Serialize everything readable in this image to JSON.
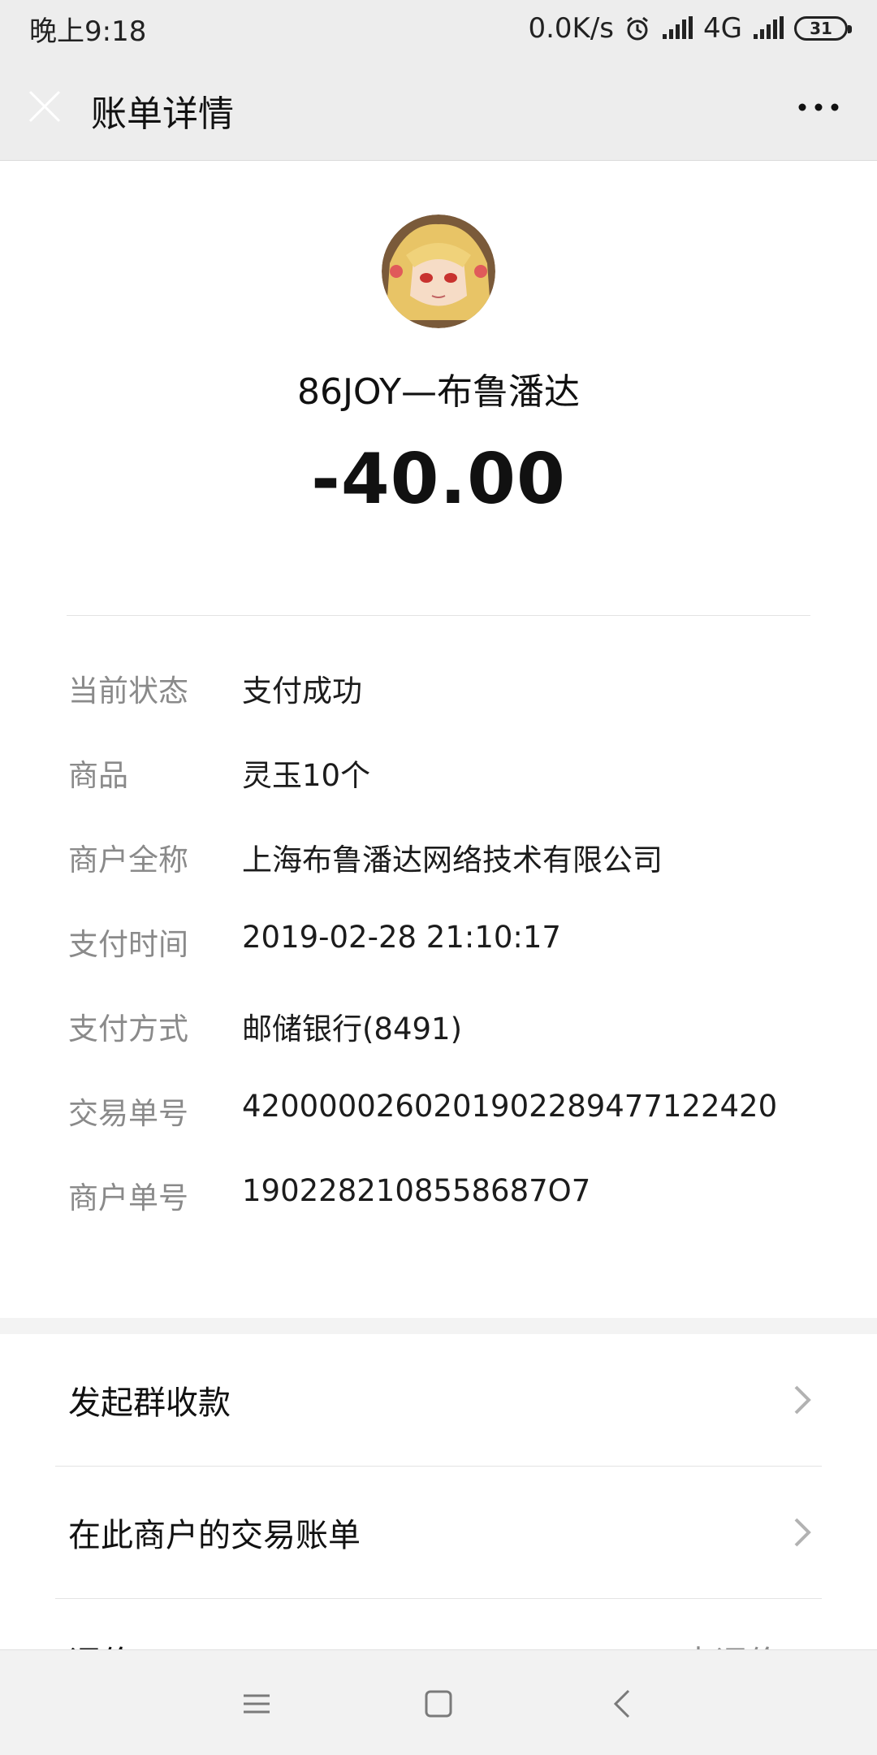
{
  "status_bar": {
    "time": "晚上9:18",
    "net_speed": "0.0K/s",
    "network": "4G",
    "battery": "31"
  },
  "header": {
    "title": "账单详情",
    "close_icon": "close-icon",
    "more_icon": "more-dots-icon"
  },
  "merchant": {
    "name": "86JOY—布鲁潘达",
    "amount": "-40.00"
  },
  "details": [
    {
      "label": "当前状态",
      "value": "支付成功"
    },
    {
      "label": "商品",
      "value": "灵玉10个"
    },
    {
      "label": "商户全称",
      "value": "上海布鲁潘达网络技术有限公司"
    },
    {
      "label": "支付时间",
      "value": "2019-02-28 21:10:17"
    },
    {
      "label": "支付方式",
      "value": "邮储银行(8491)"
    },
    {
      "label": "交易单号",
      "value": "4200000260201902289477122420"
    },
    {
      "label": "商户单号",
      "value": "1902282108558687O7"
    }
  ],
  "actions": [
    {
      "label": "发起群收款"
    },
    {
      "label": "在此商户的交易账单"
    }
  ],
  "partial_row": {
    "left": "评价",
    "right": "去评价"
  },
  "colors": {
    "background": "#ffffff",
    "header": "#ededed",
    "label": "#8a8a8a"
  }
}
